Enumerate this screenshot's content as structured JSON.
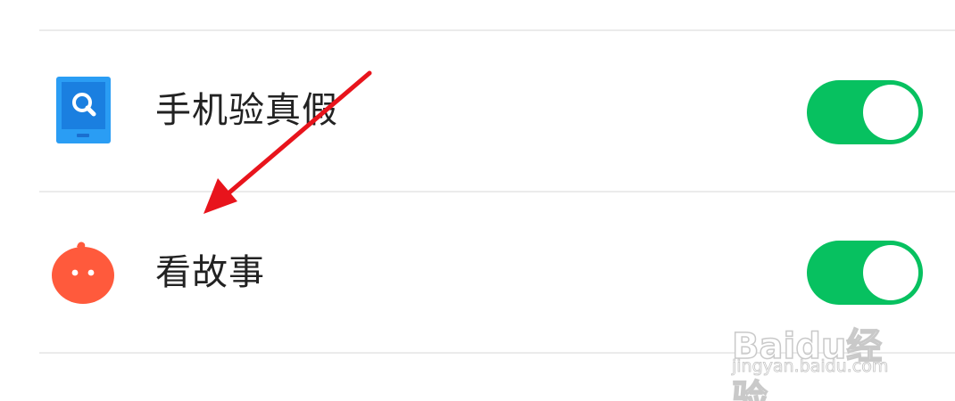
{
  "settings_list": {
    "items": [
      {
        "label": "手机验真假",
        "icon": "phone-verify-icon",
        "icon_color": "#2a9df4",
        "enabled": true
      },
      {
        "label": "看故事",
        "icon": "story-mascot-icon",
        "icon_color": "#ff5a3c",
        "enabled": true
      }
    ]
  },
  "colors": {
    "toggle_on": "#07c160",
    "annotation_arrow": "#e8141c",
    "divider": "#ebebeb"
  },
  "watermark": {
    "brand": "Baidu经验",
    "url": "jingyan.baidu.com"
  }
}
